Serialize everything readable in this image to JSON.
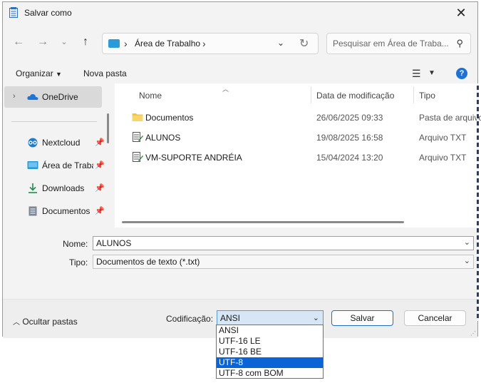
{
  "window": {
    "title": "Salvar como",
    "close_glyph": "✕"
  },
  "address_bar": {
    "path": "Área de Trabalho",
    "separator": "›"
  },
  "search": {
    "placeholder": "Pesquisar em Área de Traba..."
  },
  "toolbar": {
    "organize_label": "Organizar",
    "new_folder_label": "Nova pasta"
  },
  "nav_pane": {
    "items": [
      {
        "label": "OneDrive",
        "icon": "cloud-icon",
        "expandable": true,
        "selected": true
      },
      {
        "label": "Nextcloud",
        "icon": "nextcloud-icon",
        "pinned": true
      },
      {
        "label": "Área de Trabalho",
        "icon": "desktop-icon",
        "pinned": true
      },
      {
        "label": "Downloads",
        "icon": "download-icon",
        "pinned": true
      },
      {
        "label": "Documentos",
        "icon": "document-icon",
        "pinned": true
      }
    ]
  },
  "file_list": {
    "columns": [
      "Nome",
      "Data de modificação",
      "Tipo"
    ],
    "rows": [
      {
        "name": "Documentos",
        "date": "26/06/2025 09:33",
        "type": "Pasta de arquivos",
        "icon": "folder-icon"
      },
      {
        "name": "ALUNOS",
        "date": "19/08/2025 16:58",
        "type": "Arquivo TXT",
        "icon": "text-file-icon"
      },
      {
        "name": "VM-SUPORTE ANDRÉIA",
        "date": "15/04/2024 13:20",
        "type": "Arquivo TXT",
        "icon": "text-file-icon"
      }
    ]
  },
  "form": {
    "name_label": "Nome:",
    "name_value": "ALUNOS",
    "type_label": "Tipo:",
    "type_value": "Documentos de texto (*.txt)"
  },
  "footer": {
    "hide_folders_label": "Ocultar pastas",
    "encoding_label": "Codificação:",
    "encoding_value": "ANSI",
    "save_label": "Salvar",
    "cancel_label": "Cancelar"
  },
  "encoding_options": [
    "ANSI",
    "UTF-16 LE",
    "UTF-16 BE",
    "UTF-8",
    "UTF-8 com BOM"
  ],
  "encoding_highlighted": "UTF-8",
  "colors": {
    "accent": "#0a64d6",
    "help_icon": "#1f72d3",
    "folder": "#f4c542"
  }
}
